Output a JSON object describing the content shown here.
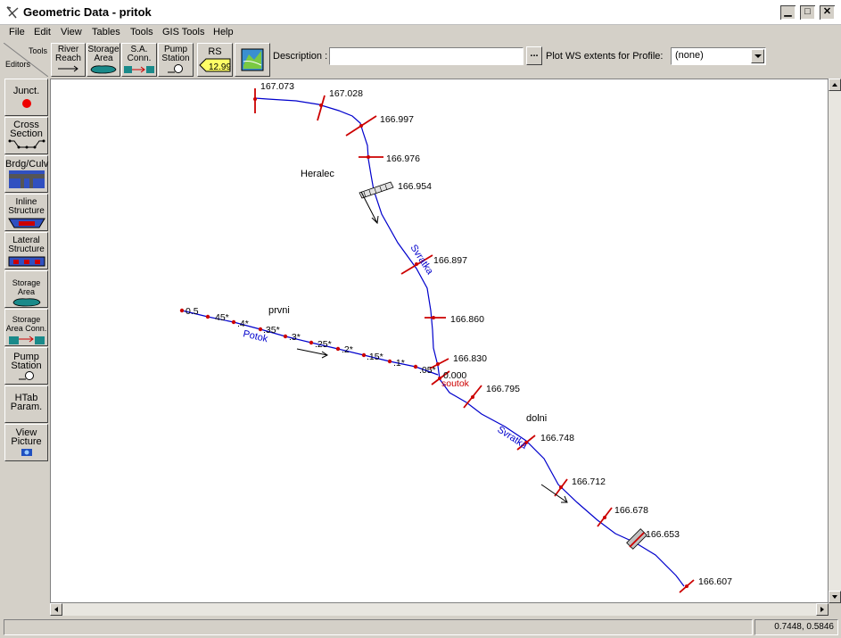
{
  "window": {
    "title": "Geometric Data - pritok"
  },
  "menu": [
    "File",
    "Edit",
    "View",
    "Tables",
    "Tools",
    "GIS Tools",
    "Help"
  ],
  "toolbar": {
    "tools_label": "Tools",
    "editors_label": "Editors",
    "river_reach": [
      "River",
      "Reach"
    ],
    "storage_area": [
      "Storage",
      "Area"
    ],
    "sa_conn": [
      "S.A.",
      "Conn."
    ],
    "pump_station": [
      "Pump",
      "Station"
    ],
    "rs_label": "RS",
    "rs_value": "12.99",
    "description_label": "Description :",
    "description_value": "",
    "ellipsis": "...",
    "plot_ws_label": "Plot WS extents for Profile:",
    "profile_value": "(none)"
  },
  "editors": [
    {
      "lines": [
        "Junct."
      ],
      "icon": "junction-icon"
    },
    {
      "lines": [
        "Cross",
        "Section"
      ],
      "icon": "cross-section-icon"
    },
    {
      "lines": [
        "Brdg/Culv"
      ],
      "icon": "bridge-culvert-icon"
    },
    {
      "lines": [
        "Inline",
        "Structure"
      ],
      "icon": "inline-structure-icon"
    },
    {
      "lines": [
        "Lateral",
        "Structure"
      ],
      "icon": "lateral-structure-icon"
    },
    {
      "lines": [
        "Storage",
        "Area"
      ],
      "icon": "storage-area-icon"
    },
    {
      "lines": [
        "Storage",
        "Area Conn."
      ],
      "icon": "storage-area-conn-icon"
    },
    {
      "lines": [
        "Pump",
        "Station"
      ],
      "icon": "pump-station-icon"
    },
    {
      "lines": [
        "HTab",
        "Param."
      ],
      "icon": "htab-icon"
    },
    {
      "lines": [
        "View",
        "Picture"
      ],
      "icon": "camera-icon"
    }
  ],
  "schematic": {
    "reach_labels": [
      "Heralec",
      "prvni",
      "dolni"
    ],
    "river_names": [
      "Svratka",
      "Potok",
      "Svratka"
    ],
    "junction_label": "soutok",
    "svratka_stations": [
      "167.073",
      "167.028",
      "166.997",
      "166.976",
      "166.954",
      "166.897",
      "166.860",
      "166.830",
      "166.795",
      "166.748",
      "166.712",
      "166.678",
      "166.653",
      "166.607"
    ],
    "potok_stations": [
      "0.5",
      "45*",
      ".4*",
      ".35*",
      ".3*",
      ".25*",
      ".2*",
      ".15*",
      ".1*",
      ".05*",
      "0.000"
    ]
  },
  "status": {
    "coordinates": "0.7448, 0.5846"
  },
  "colors": {
    "river": "#0000cc",
    "xs": "#cc0000",
    "junction_text": "#cc0000"
  }
}
